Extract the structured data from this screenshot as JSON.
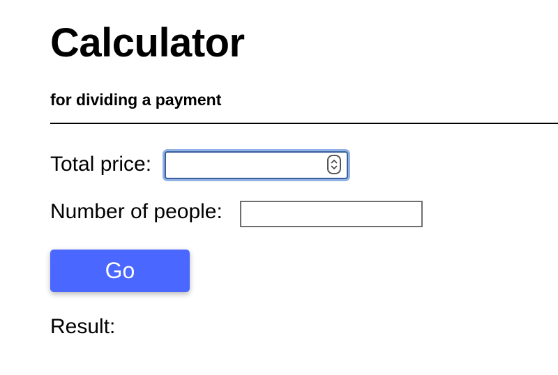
{
  "header": {
    "title": "Calculator",
    "subtitle": "for dividing a payment"
  },
  "form": {
    "total_price": {
      "label": "Total price:",
      "value": "",
      "placeholder": ""
    },
    "number_of_people": {
      "label": "Number of people:",
      "value": "",
      "placeholder": ""
    },
    "go_button_label": "Go"
  },
  "result": {
    "label": "Result:",
    "value": ""
  },
  "colors": {
    "button_background": "#4a67ff",
    "button_text": "#ffffff",
    "focus_ring": "#8fb1e6",
    "focused_border": "#3b5f9a",
    "divider": "#000000"
  },
  "icons": {
    "spinner": "number-spinner-icon"
  }
}
